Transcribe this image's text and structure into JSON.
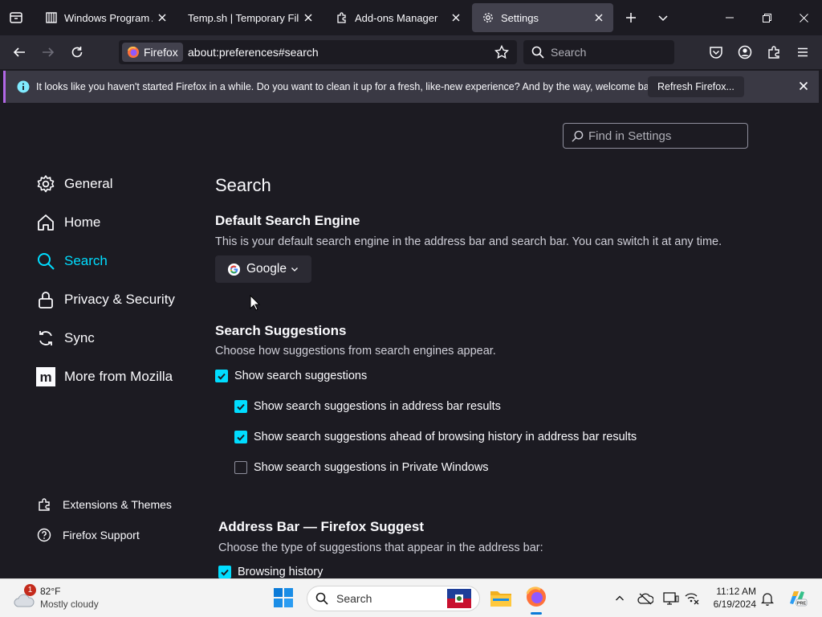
{
  "tabs": [
    {
      "title": "Windows Program Arc",
      "icon": "archive-icon",
      "active": false
    },
    {
      "title": "Temp.sh | Temporary File U",
      "icon": "none",
      "active": false
    },
    {
      "title": "Add-ons Manager",
      "icon": "puzzle-icon",
      "active": false
    },
    {
      "title": "Settings",
      "icon": "gear-icon",
      "active": true
    }
  ],
  "navbar": {
    "identity_label": "Firefox",
    "url": "about:preferences#search",
    "search_placeholder": "Search"
  },
  "notification": {
    "message": "It looks like you haven't started Firefox in a while. Do you want to clean it up for a fresh, like-new experience? And by the way, welcome back!",
    "button_label": "Refresh Firefox..."
  },
  "find_placeholder": "Find in Settings",
  "categories": [
    {
      "label": "General",
      "icon": "gear-icon",
      "selected": false
    },
    {
      "label": "Home",
      "icon": "home-icon",
      "selected": false
    },
    {
      "label": "Search",
      "icon": "search-icon",
      "selected": true
    },
    {
      "label": "Privacy & Security",
      "icon": "lock-icon",
      "selected": false
    },
    {
      "label": "Sync",
      "icon": "sync-icon",
      "selected": false
    },
    {
      "label": "More from Mozilla",
      "icon": "mozilla-icon",
      "selected": false
    }
  ],
  "footer_links": [
    {
      "label": "Extensions & Themes",
      "icon": "puzzle-icon"
    },
    {
      "label": "Firefox Support",
      "icon": "help-icon"
    }
  ],
  "main": {
    "title": "Search",
    "default_engine": {
      "heading": "Default Search Engine",
      "description": "This is your default search engine in the address bar and search bar. You can switch it at any time.",
      "selected_engine": "Google"
    },
    "suggestions": {
      "heading": "Search Suggestions",
      "description": "Choose how suggestions from search engines appear.",
      "options": [
        {
          "label": "Show search suggestions",
          "checked": true
        },
        {
          "label": "Show search suggestions in address bar results",
          "checked": true
        },
        {
          "label": "Show search suggestions ahead of browsing history in address bar results",
          "checked": true
        },
        {
          "label": "Show search suggestions in Private Windows",
          "checked": false
        }
      ]
    },
    "address_bar": {
      "heading": "Address Bar — Firefox Suggest",
      "description": "Choose the type of suggestions that appear in the address bar:",
      "options": [
        {
          "label": "Browsing history",
          "checked": true
        }
      ]
    }
  },
  "taskbar": {
    "weather_temp": "82°F",
    "weather_desc": "Mostly cloudy",
    "weather_badge": "1",
    "search_label": "Search",
    "time": "11:12 AM",
    "date": "6/19/2024"
  },
  "colors": {
    "accent": "#00ddff",
    "background": "#1c1b22",
    "toolbar": "#2b2a33",
    "notification_border": "#b267e6"
  }
}
